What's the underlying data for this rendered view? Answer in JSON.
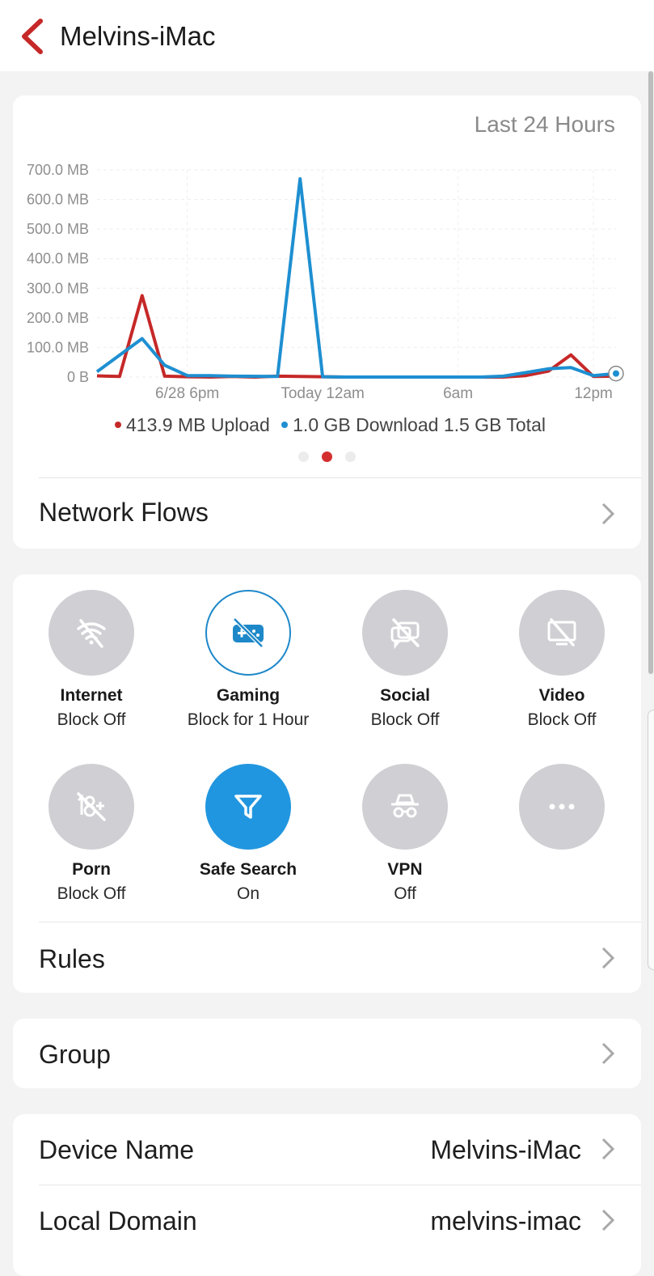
{
  "header": {
    "title": "Melvins-iMac"
  },
  "range_label": "Last 24 Hours",
  "chart_data": {
    "type": "line",
    "y_ticks": [
      "700.0 MB",
      "600.0 MB",
      "500.0 MB",
      "400.0 MB",
      "300.0 MB",
      "200.0 MB",
      "100.0 MB",
      "0 B"
    ],
    "x_ticks": [
      "6/28 6pm",
      "Today 12am",
      "6am",
      "12pm"
    ],
    "ylim": [
      0,
      700
    ],
    "y_unit": "MB",
    "x_unit": "hours (approx.)",
    "xlim": [
      0,
      23
    ],
    "grid": true,
    "series": [
      {
        "name": "Upload",
        "color": "#c62828",
        "points": [
          [
            0,
            4
          ],
          [
            1,
            2
          ],
          [
            2,
            275
          ],
          [
            3,
            3
          ],
          [
            4,
            1
          ],
          [
            5,
            0
          ],
          [
            6,
            2
          ],
          [
            7,
            0
          ],
          [
            8,
            3
          ],
          [
            9,
            2
          ],
          [
            10,
            1
          ],
          [
            11,
            0
          ],
          [
            12,
            0
          ],
          [
            13,
            0
          ],
          [
            14,
            0
          ],
          [
            15,
            0
          ],
          [
            16,
            0
          ],
          [
            17,
            0
          ],
          [
            18,
            0
          ],
          [
            19,
            5
          ],
          [
            20,
            20
          ],
          [
            21,
            75
          ],
          [
            22,
            2
          ],
          [
            23,
            3
          ]
        ]
      },
      {
        "name": "Download",
        "color": "#1e8fd1",
        "points": [
          [
            0,
            18
          ],
          [
            2,
            130
          ],
          [
            3,
            40
          ],
          [
            4,
            5
          ],
          [
            5,
            5
          ],
          [
            6,
            3
          ],
          [
            8,
            2
          ],
          [
            9,
            670
          ],
          [
            10,
            1
          ],
          [
            11,
            0
          ],
          [
            12,
            0
          ],
          [
            13,
            0
          ],
          [
            14,
            0
          ],
          [
            15,
            0
          ],
          [
            16,
            0
          ],
          [
            17,
            0
          ],
          [
            18,
            3
          ],
          [
            19,
            15
          ],
          [
            20,
            28
          ],
          [
            21,
            32
          ],
          [
            22,
            5
          ],
          [
            23,
            12
          ]
        ]
      }
    ]
  },
  "legend": {
    "upload": "413.9 MB Upload",
    "download": "1.0 GB Download",
    "total": "1.5 GB Total",
    "upload_color": "#c62828",
    "download_color": "#1e8fd1"
  },
  "pager": {
    "pages": 3,
    "active": 1
  },
  "network_flows": "Network Flows",
  "controls": [
    {
      "title": "Internet",
      "status": "Block Off",
      "icon": "wifi-off-icon",
      "style": "gray"
    },
    {
      "title": "Gaming",
      "status": "Block for 1 Hour",
      "icon": "gamepad-off-icon",
      "style": "outline"
    },
    {
      "title": "Social",
      "status": "Block Off",
      "icon": "chat-off-icon",
      "style": "gray"
    },
    {
      "title": "Video",
      "status": "Block Off",
      "icon": "monitor-off-icon",
      "style": "gray"
    },
    {
      "title": "Porn",
      "status": "Block Off",
      "icon": "eighteen-plus-off-icon",
      "style": "gray"
    },
    {
      "title": "Safe Search",
      "status": "On",
      "icon": "filter-icon",
      "style": "filled"
    },
    {
      "title": "VPN",
      "status": "Off",
      "icon": "spy-icon",
      "style": "gray"
    },
    {
      "title": "",
      "status": "",
      "icon": "more-icon",
      "style": "gray"
    }
  ],
  "rules": "Rules",
  "group": "Group",
  "device": {
    "name_label": "Device Name",
    "name_value": "Melvins-iMac",
    "domain_label": "Local Domain",
    "domain_value": "melvins-imac"
  },
  "colors": {
    "accent_red": "#d32f2f",
    "accent_blue": "#2196e0",
    "icon_gray": "#cfcfd4"
  }
}
